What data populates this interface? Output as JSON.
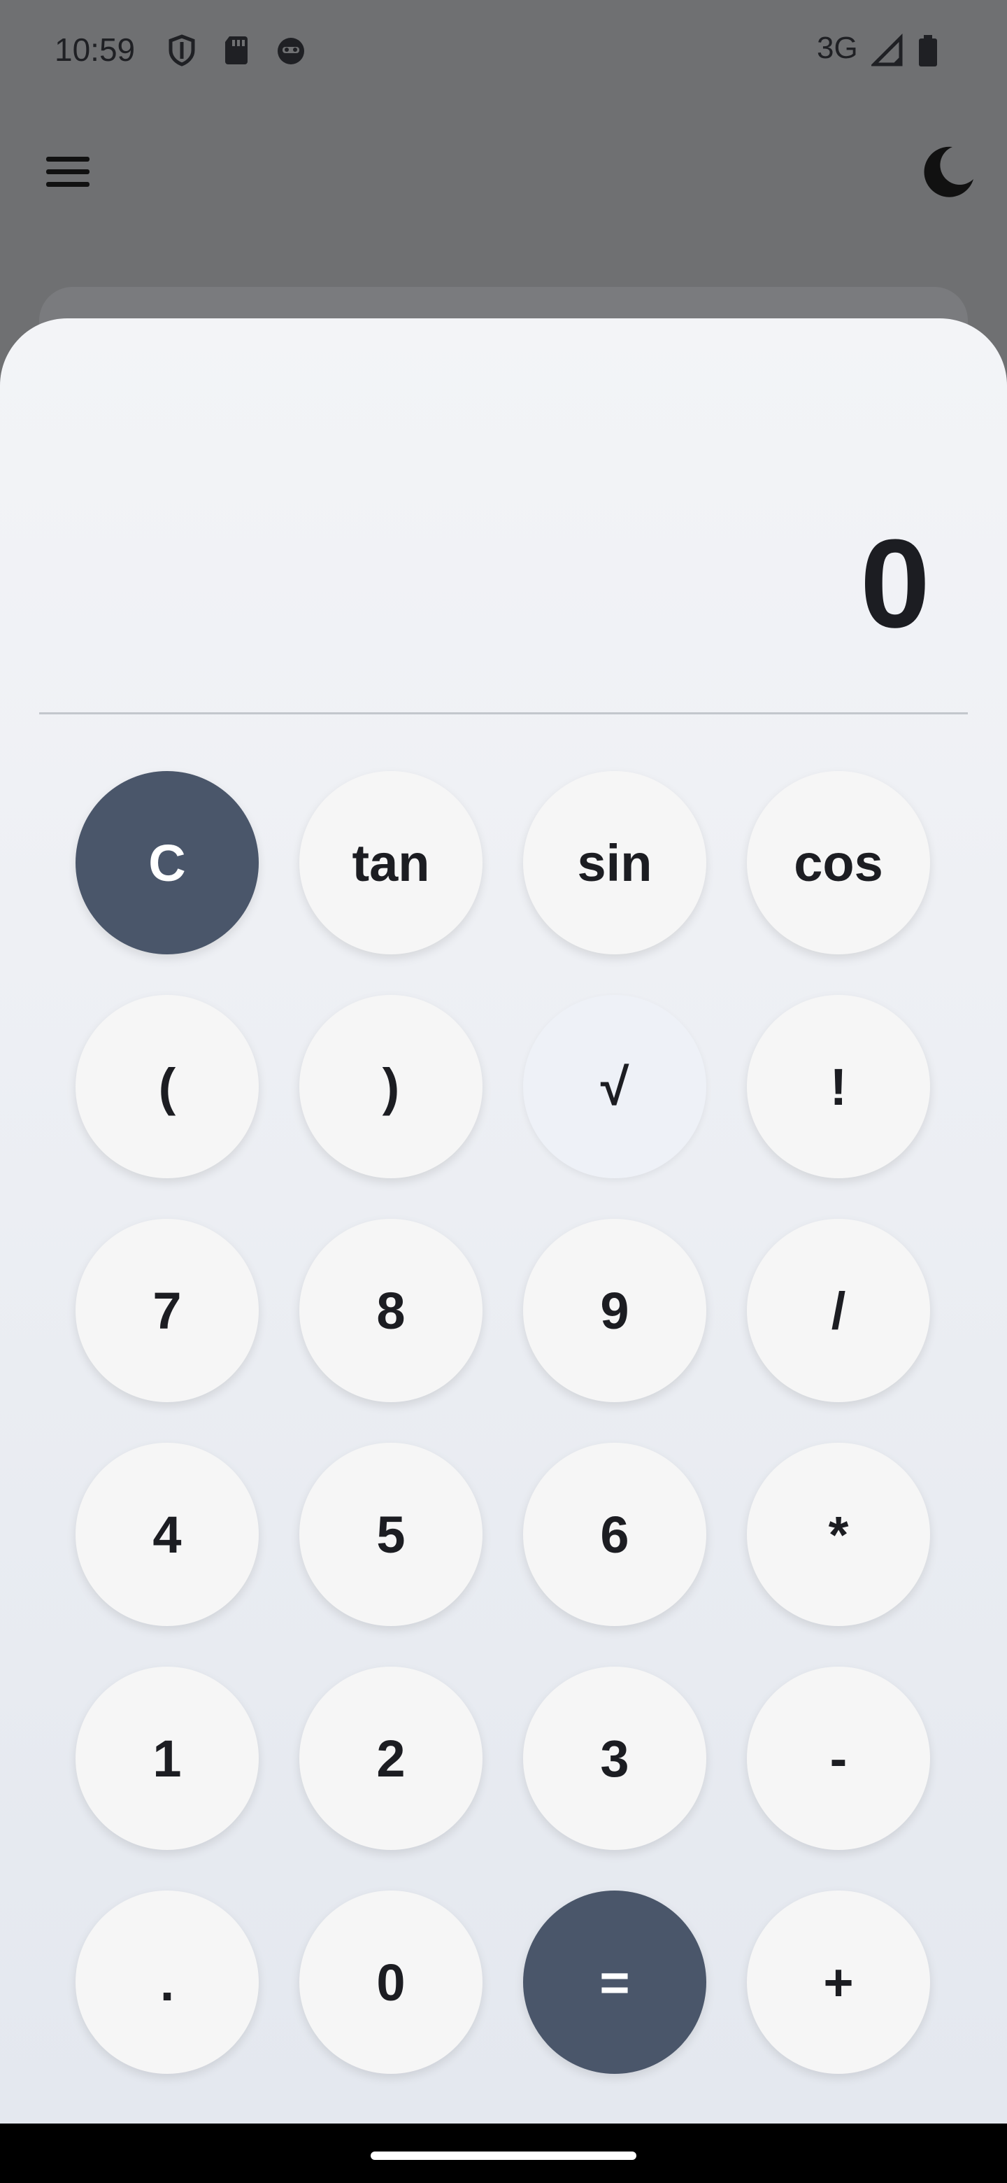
{
  "status_bar": {
    "time": "10:59",
    "network": "3G",
    "icons": [
      "shield-icon",
      "sd-card-icon",
      "app-face-icon",
      "signal-icon",
      "battery-icon"
    ]
  },
  "app_bar": {
    "menu_icon": "hamburger-menu-icon",
    "theme_icon": "moon-icon"
  },
  "display": {
    "value": "0"
  },
  "keys": [
    [
      "C",
      "tan",
      "sin",
      "cos"
    ],
    [
      "(",
      ")",
      "√",
      "!"
    ],
    [
      "7",
      "8",
      "9",
      "/"
    ],
    [
      "4",
      "5",
      "6",
      "*"
    ],
    [
      "1",
      "2",
      "3",
      "-"
    ],
    [
      ".",
      "0",
      "=",
      "+"
    ]
  ],
  "colors": {
    "accent_dark": "#4a566a",
    "key_bg": "#f6f6f6",
    "scrim": "#6f7072"
  }
}
